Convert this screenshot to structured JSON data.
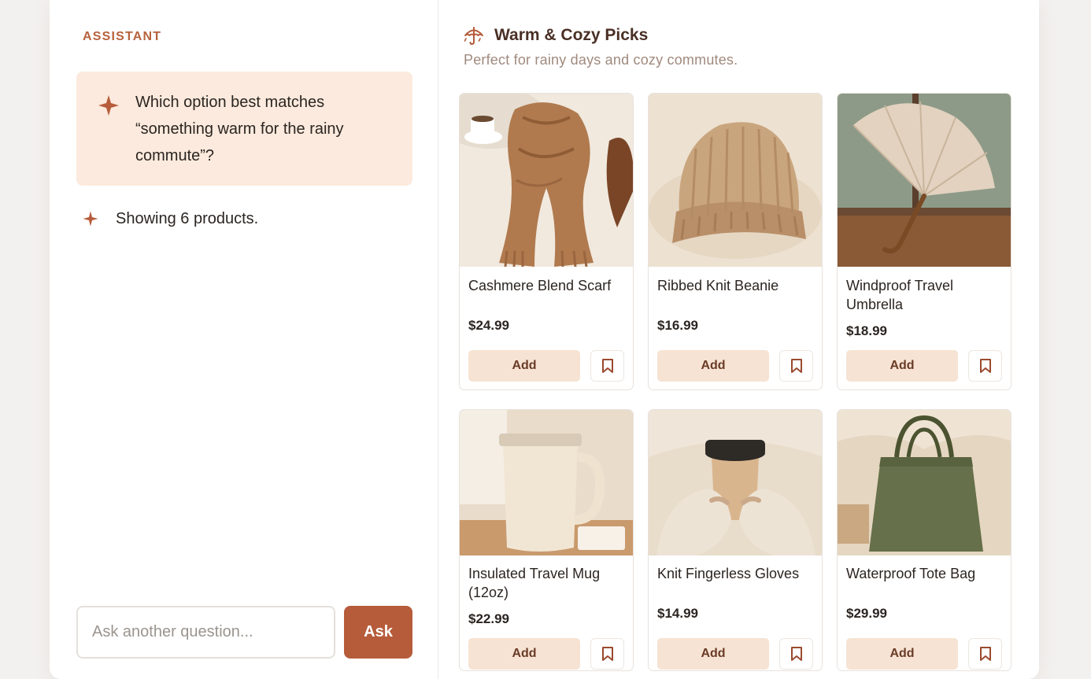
{
  "assistant": {
    "role_label": "ASSISTANT",
    "question": "Which option best matches “something warm for the rainy commute”?",
    "status": "Showing 6 products."
  },
  "composer": {
    "placeholder": "Ask another question...",
    "value": "",
    "ask_label": "Ask"
  },
  "picks": {
    "title": "Warm & Cozy Picks",
    "subtitle": "Perfect for rainy days and cozy commutes.",
    "add_label": "Add",
    "products": [
      {
        "name": "Cashmere Blend Scarf",
        "price": "$24.99",
        "image": "scarf-photo"
      },
      {
        "name": "Ribbed Knit Beanie",
        "price": "$16.99",
        "image": "beanie-photo"
      },
      {
        "name": "Windproof Travel Umbrella",
        "price": "$18.99",
        "image": "umbrella-photo"
      },
      {
        "name": "Insulated Travel Mug (12oz)",
        "price": "$22.99",
        "image": "mug-photo"
      },
      {
        "name": "Knit Fingerless Gloves",
        "price": "$14.99",
        "image": "gloves-photo"
      },
      {
        "name": "Waterproof Tote Bag",
        "price": "$29.99",
        "image": "tote-photo"
      }
    ]
  },
  "colors": {
    "accent": "#b65c3b",
    "accent_soft": "#fbeadd",
    "add_button_bg": "#f6e3d3",
    "title_text": "#4a2f25"
  },
  "icons": {
    "sparkle": "sparkle-icon",
    "umbrella": "umbrella-icon",
    "save": "bookmark-icon"
  }
}
